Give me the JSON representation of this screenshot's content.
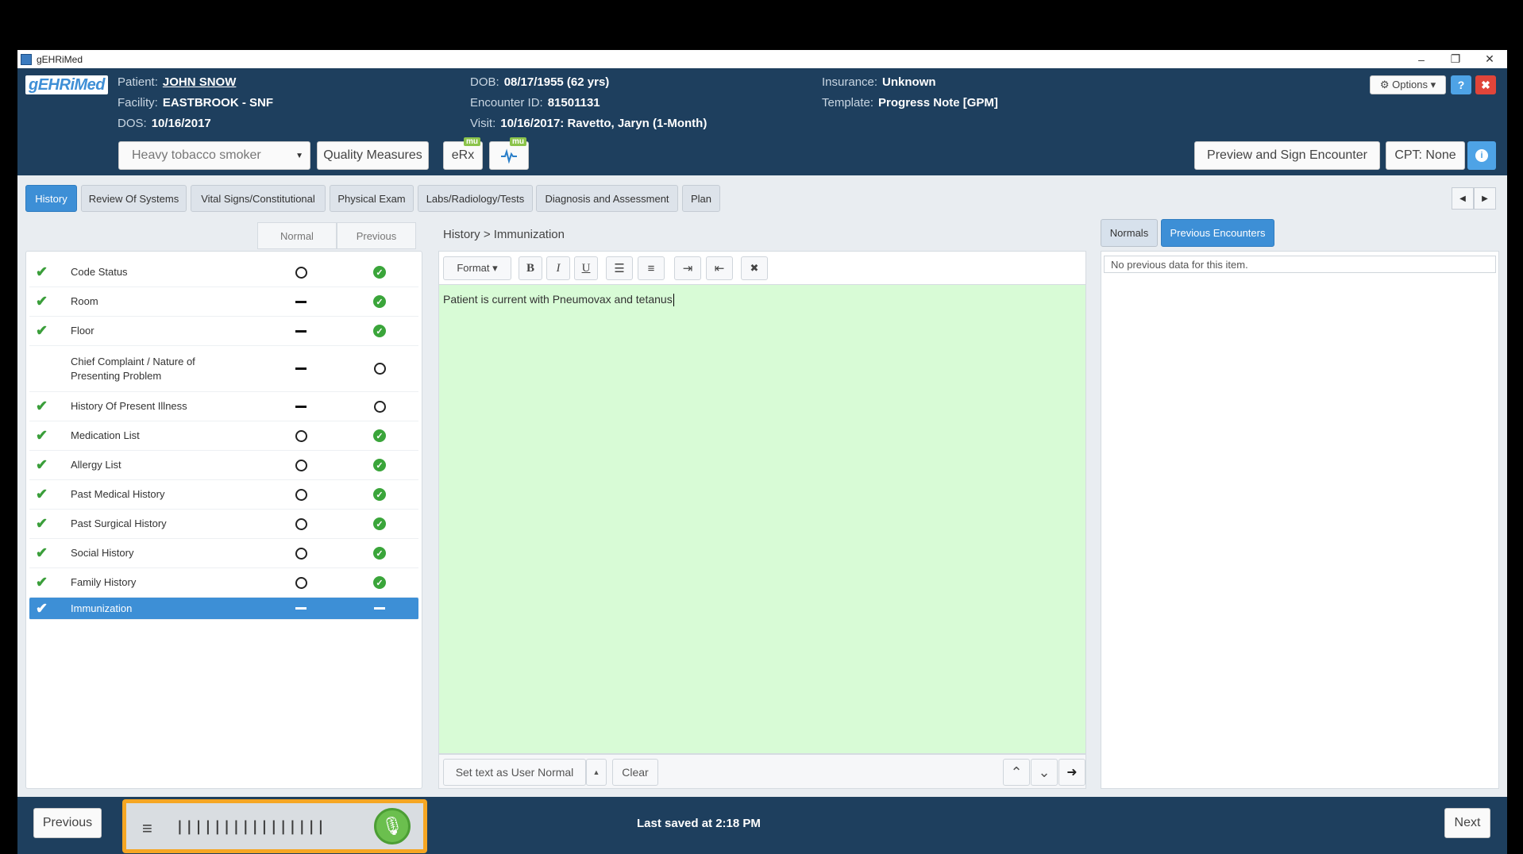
{
  "window": {
    "title": "gEHRiMed",
    "minimize": "–",
    "restore": "❐",
    "close": "✕"
  },
  "header": {
    "logo": "gEHRiMed",
    "patient_label": "Patient:",
    "patient": "JOHN SNOW",
    "facility_label": "Facility:",
    "facility": "EASTBROOK - SNF",
    "dos_label": "DOS:",
    "dos": "10/16/2017",
    "dob_label": "DOB:",
    "dob": "08/17/1955 (62 yrs)",
    "encounter_label": "Encounter ID:",
    "encounter": "81501131",
    "visit_label": "Visit:",
    "visit": "10/16/2017: Ravetto, Jaryn (1-Month)",
    "insurance_label": "Insurance:",
    "insurance": "Unknown",
    "template_label": "Template:",
    "template": "Progress Note [GPM]",
    "options": "⚙ Options ▾",
    "help_icon": "?",
    "close_icon": "✖",
    "problem_select": "Heavy tobacco smoker",
    "quality_measures": "Quality Measures",
    "erx": "eRx",
    "mu_badge": "mu",
    "preview_sign": "Preview and Sign Encounter",
    "cpt": "CPT: None",
    "info_icon": "i"
  },
  "tabs": [
    {
      "label": "History",
      "active": true
    },
    {
      "label": "Review Of Systems"
    },
    {
      "label": "Vital Signs/Constitutional"
    },
    {
      "label": "Physical Exam"
    },
    {
      "label": "Labs/Radiology/Tests"
    },
    {
      "label": "Diagnosis and Assessment"
    },
    {
      "label": "Plan"
    }
  ],
  "nav": {
    "prev": "◀",
    "next": "▶"
  },
  "left": {
    "col_normal": "Normal",
    "col_previous": "Previous",
    "items": [
      {
        "label": "Code Status",
        "checked": true,
        "normal": "circle",
        "previous": "check"
      },
      {
        "label": "Room",
        "checked": true,
        "normal": "dash",
        "previous": "check"
      },
      {
        "label": "Floor",
        "checked": true,
        "normal": "dash",
        "previous": "check"
      },
      {
        "label": "Chief Complaint / Nature of Presenting Problem",
        "checked": false,
        "normal": "dash",
        "previous": "circle"
      },
      {
        "label": "History Of Present Illness",
        "checked": true,
        "normal": "dash",
        "previous": "circle"
      },
      {
        "label": "Medication List",
        "checked": true,
        "normal": "circle",
        "previous": "check"
      },
      {
        "label": "Allergy List",
        "checked": true,
        "normal": "circle",
        "previous": "check"
      },
      {
        "label": "Past Medical History",
        "checked": true,
        "normal": "circle",
        "previous": "check"
      },
      {
        "label": "Past Surgical History",
        "checked": true,
        "normal": "circle",
        "previous": "check"
      },
      {
        "label": "Social History",
        "checked": true,
        "normal": "circle",
        "previous": "check"
      },
      {
        "label": "Family History",
        "checked": true,
        "normal": "circle",
        "previous": "check"
      },
      {
        "label": "Immunization",
        "checked": true,
        "normal": "dash",
        "previous": "dash",
        "selected": true
      }
    ]
  },
  "editor": {
    "breadcrumb": "History > Immunization",
    "format": "Format ▾",
    "bold": "B",
    "italic": "I",
    "underline": "U",
    "bullet_list": "☰",
    "numbered_list": "≡",
    "indent": "⇥",
    "outdent": "⇤",
    "clear_format": "✖",
    "text": "Patient is current with Pneumovax and tetanus",
    "set_user_normal": "Set text as User Normal",
    "caret_up": "▲",
    "clear": "Clear",
    "up": "⌃",
    "down": "⌄",
    "go": "➜"
  },
  "right": {
    "normals_tab": "Normals",
    "previous_tab": "Previous Encounters",
    "no_data": "No previous data for this item."
  },
  "footer": {
    "previous": "Previous",
    "next": "Next",
    "saved": "Last saved at 2:18 PM",
    "voice_bars": "||||||||||||||||",
    "menu_icon": "≡",
    "mic_icon": "🎙"
  },
  "colors": {
    "accent": "#3d8fd6",
    "header_bg": "#1e3f5e",
    "editor_bg": "#d8fbd6",
    "voice_border": "#f5a623",
    "check_green": "#3aa53a"
  }
}
